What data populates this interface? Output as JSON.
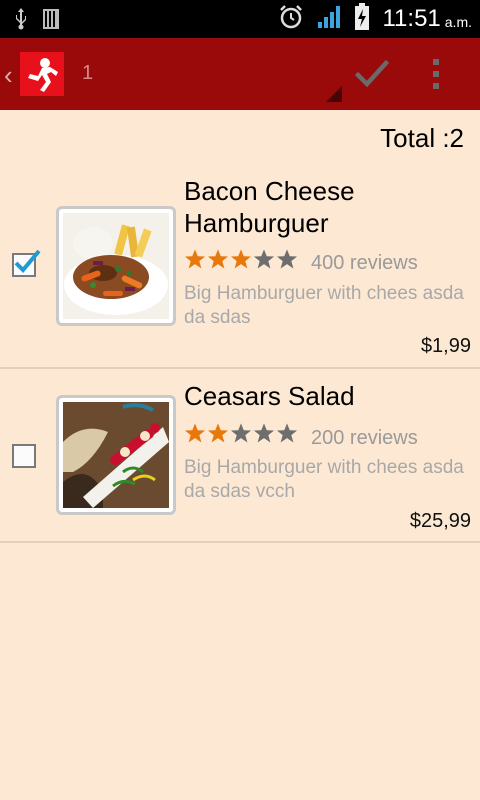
{
  "status_bar": {
    "time": "11:51",
    "ampm": "a.m.",
    "icons": [
      "usb-icon",
      "sd-card-icon",
      "alarm-icon",
      "signal-icon",
      "battery-charging-icon"
    ]
  },
  "action_bar": {
    "count": "1",
    "icons": [
      "back-chevron-icon",
      "app-logo-icon",
      "checkmark-icon",
      "overflow-menu-icon"
    ],
    "accent_color": "#9b0a0a"
  },
  "summary": {
    "total_label": "Total :2"
  },
  "items": [
    {
      "title": "Bacon Cheese Hamburguer",
      "rating": 3,
      "rating_max": 5,
      "reviews": "400 reviews",
      "description": "Big Hamburguer with chees asda da sdas",
      "price": "$1,99",
      "checked": true
    },
    {
      "title": "Ceasars Salad",
      "rating": 2,
      "rating_max": 5,
      "reviews": "200 reviews",
      "description": "Big Hamburguer with chees asda da sdas vcch",
      "price": "$25,99",
      "checked": false
    }
  ],
  "colors": {
    "background": "#fde9d3",
    "star_filled": "#e8780c",
    "star_empty": "#6e6e6e",
    "checkbox_accent": "#1e9ad6"
  }
}
